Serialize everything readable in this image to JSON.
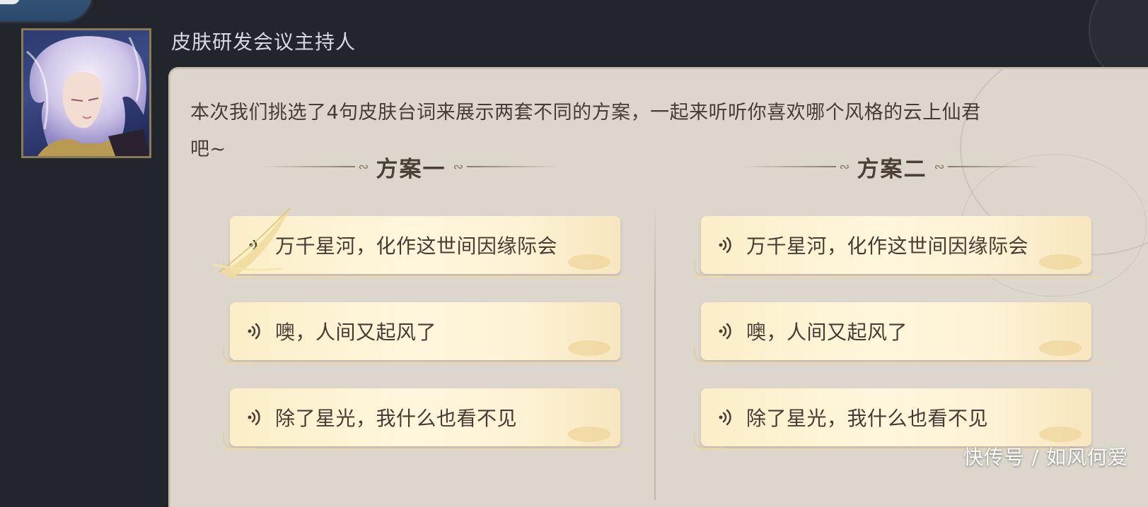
{
  "speaker": {
    "name": "皮肤研发会议主持人"
  },
  "dialog": {
    "intro_line1": "本次我们挑选了4句皮肤台词来展示两套不同的方案，一起来听听你喜欢哪个风格的云上仙君",
    "intro_line2": "吧~"
  },
  "plans": [
    {
      "title": "方案一",
      "lines": [
        "万千星河，化作这世间因缘际会",
        "噢，人间又起风了",
        "除了星光，我什么也看不见"
      ]
    },
    {
      "title": "方案二",
      "lines": [
        "万千星河，化作这世间因缘际会",
        "噢，人间又起风了",
        "除了星光，我什么也看不见"
      ]
    }
  ],
  "icons": {
    "voice": "voice-play-icon",
    "avatar": "character-portrait"
  },
  "colors": {
    "background": "#23252d",
    "panel": "#ddd6cc",
    "card": "#fbeec8",
    "text_dark": "#463c32",
    "accent_tab": "#2a4a6e"
  },
  "watermark": "快传号 / 如风何爱"
}
